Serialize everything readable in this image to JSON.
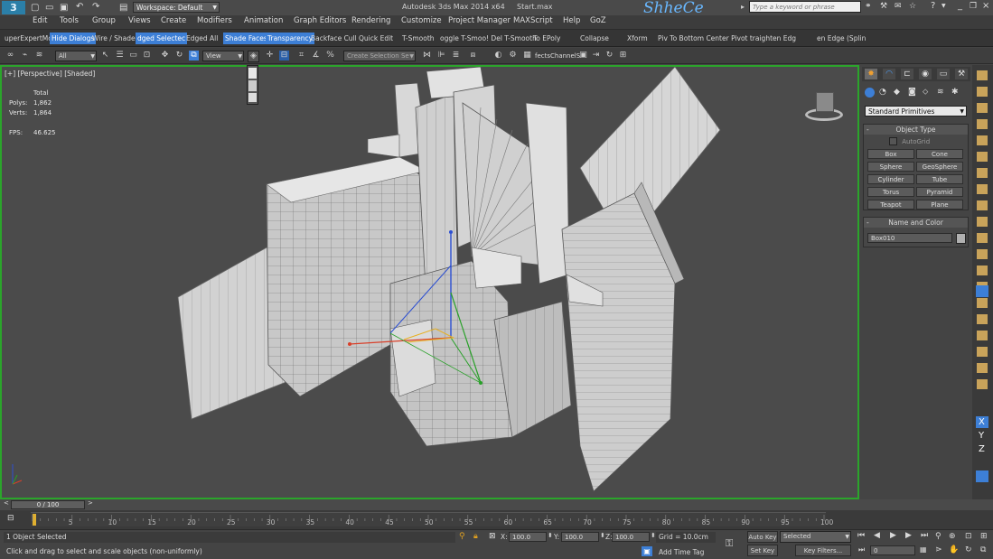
{
  "title": {
    "workspace": "Workspace: Default",
    "app_name": "Autodesk 3ds Max  2014 x64",
    "file_name": "Start.max",
    "watermark": "ShheCe",
    "search_placeholder": "Type a keyword or phrase"
  },
  "menu": [
    "Edit",
    "Tools",
    "Group",
    "Views",
    "Create",
    "Modifiers",
    "Animation",
    "Graph Editors",
    "Rendering",
    "Customize",
    "Project Manager",
    "MAXScript",
    "Help",
    "GoZ"
  ],
  "ribbon": [
    {
      "label": "uperExpertMo",
      "active": false
    },
    {
      "label": "Hide Dialogs",
      "active": true
    },
    {
      "label": "Wire / Shaded",
      "active": false
    },
    {
      "label": "dged Selectec",
      "active": true
    },
    {
      "label": "Edged All",
      "active": false
    },
    {
      "label": "Shade Faces",
      "active": true
    },
    {
      "label": "Transparency",
      "active": true
    },
    {
      "label": "Backface Cull",
      "active": false
    },
    {
      "label": "Quick Edit",
      "active": false
    },
    {
      "label": "T-Smooth",
      "active": false
    },
    {
      "label": "oggle T-Smoo! Del T-Smooth",
      "active": false
    },
    {
      "label": "To EPoly",
      "active": false
    },
    {
      "label": "Collapse",
      "active": false
    },
    {
      "label": "Xform",
      "active": false
    },
    {
      "label": "Piv To Bottom Center Pivot  traighten Edg",
      "active": false
    },
    {
      "label": "en Edge (Splin",
      "active": false
    }
  ],
  "toolbar": {
    "filter_value": "All",
    "ref_coord_value": "View",
    "selection_set_placeholder": "Create Selection Se",
    "effects_label": "fectsChannelS"
  },
  "viewport": {
    "label": "[+] [Perspective] [Shaded]",
    "stats_header": "Total",
    "polys_label": "Polys:",
    "polys_value": "1,862",
    "verts_label": "Verts:",
    "verts_value": "1,864",
    "fps_label": "FPS:",
    "fps_value": "46.625"
  },
  "command_panel": {
    "category": "Standard Primitives",
    "object_type_title": "Object Type",
    "autogrid_label": "AutoGrid",
    "buttons": [
      "Box",
      "Cone",
      "Sphere",
      "GeoSphere",
      "Cylinder",
      "Tube",
      "Torus",
      "Pyramid",
      "Teapot",
      "Plane"
    ],
    "name_color_title": "Name and Color",
    "object_name": "Box010",
    "object_color": "#b0b0b0"
  },
  "timeline": {
    "frame_display": "0 / 100",
    "ticks": [
      "0",
      "5",
      "10",
      "15",
      "20",
      "25",
      "30",
      "35",
      "40",
      "45",
      "50",
      "55",
      "60",
      "65",
      "70",
      "75",
      "80",
      "85",
      "90",
      "95",
      "100"
    ]
  },
  "status": {
    "selection": "1 Object Selected",
    "prompt": "Click and drag to select and scale objects (non-uniformly)",
    "x_label": "X:",
    "x_value": "100.0",
    "y_label": "Y:",
    "y_value": "100.0",
    "z_label": "Z:",
    "z_value": "100.0",
    "grid": "Grid = 10.0cm",
    "add_time_tag": "Add Time Tag",
    "auto_key": "Auto Key",
    "set_key": "Set Key",
    "key_mode": "Selected",
    "key_filters": "Key Filters...",
    "frame_value": "0"
  },
  "axis_labels": [
    "X",
    "Y",
    "Z"
  ],
  "colors": {
    "viewport_border": "#2ba52b",
    "highlight_blue": "#3d7fd6",
    "gizmo_x": "#d8402a",
    "gizmo_y": "#28a028",
    "gizmo_z": "#2c4fd2"
  }
}
